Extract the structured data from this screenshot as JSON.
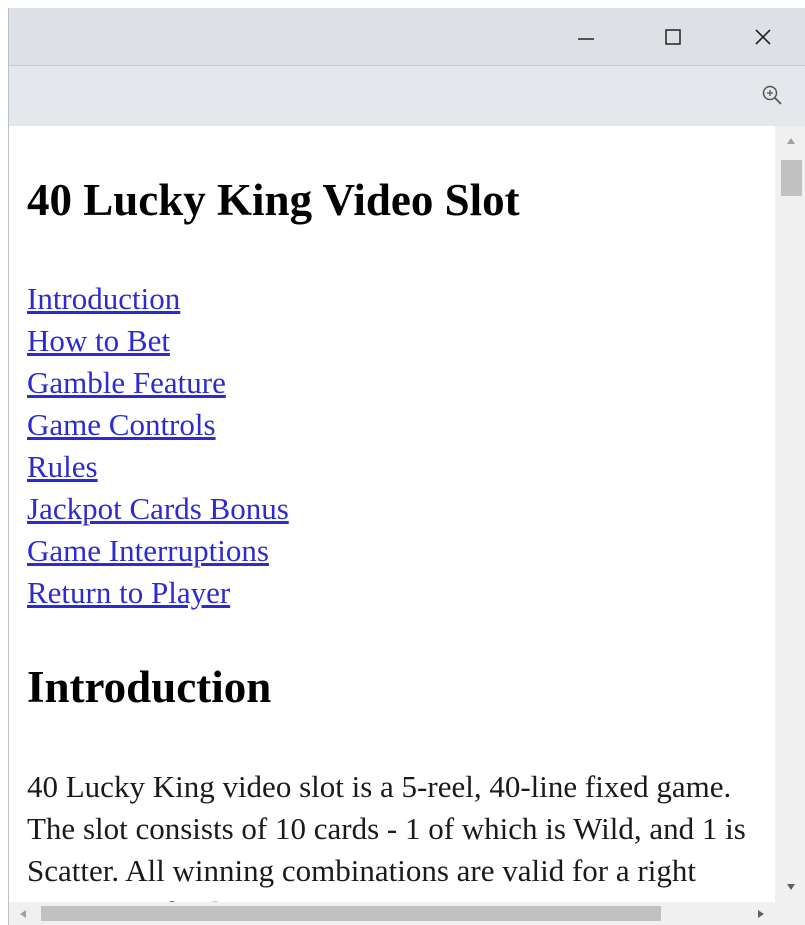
{
  "window": {
    "controls": {
      "minimize_icon": "minimize-icon",
      "maximize_icon": "maximize-icon",
      "close_icon": "close-icon"
    },
    "toolbar": {
      "zoom_icon": "zoom-in-icon"
    }
  },
  "page": {
    "title": "40 Lucky King Video Slot",
    "toc": [
      "Introduction",
      "How to Bet",
      "Gamble Feature",
      "Game Controls",
      "Rules",
      "Jackpot Cards Bonus",
      "Game Interruptions",
      "Return to Player"
    ],
    "intro": {
      "heading": "Introduction",
      "text": "40 Lucky King video slot is a 5-reel, 40-line fixed game. The slot consists of 10 cards - 1 of which is Wild, and 1 is Scatter. All winning combinations are valid for a right sequence of at least..."
    }
  },
  "colors": {
    "titlebar": "#dde1e6",
    "toolbar": "#e4e7eb",
    "link": "#2b2bd1"
  }
}
